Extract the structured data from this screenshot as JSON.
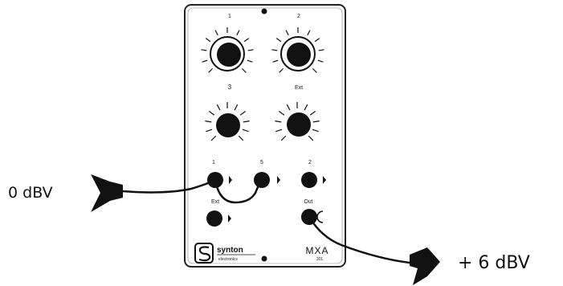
{
  "labels": {
    "input_level": "0 dBV",
    "output_level": "+ 6 dBV"
  },
  "module": {
    "brand": "synton",
    "brand_sub": "electronics",
    "model": "MXA",
    "model_sub": "301",
    "knob_labels": [
      "1",
      "2",
      "3",
      "Ext"
    ],
    "jack_labels": [
      "1",
      "5",
      "2",
      "Ext",
      "Out"
    ]
  },
  "colors": {
    "ink": "#111111",
    "panel": "#ffffff",
    "cable": "#111111"
  }
}
